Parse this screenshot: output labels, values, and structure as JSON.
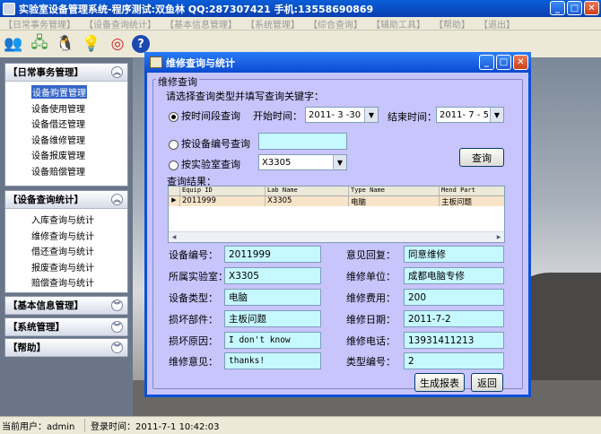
{
  "app": {
    "title": "实验室设备管理系统-程序测试:双鱼林 QQ:287307421 手机:13558690869"
  },
  "menu": [
    "【日常事务管理】",
    "【设备查询统计】",
    "【基本信息管理】",
    "【系统管理】",
    "【综合查询】",
    "【辅助工具】",
    "【帮助】",
    "【退出】"
  ],
  "sidebar": {
    "panels": [
      {
        "title": "【日常事务管理】",
        "items": [
          "设备购置管理",
          "设备使用管理",
          "设备借还管理",
          "设备维修管理",
          "设备报废管理",
          "设备赔偿管理"
        ]
      },
      {
        "title": "【设备查询统计】",
        "items": [
          "入库查询与统计",
          "维修查询与统计",
          "借还查询与统计",
          "报废查询与统计",
          "赔偿查询与统计"
        ]
      },
      {
        "title": "【基本信息管理】"
      },
      {
        "title": "【系统管理】"
      },
      {
        "title": "【帮助】"
      }
    ]
  },
  "dialog": {
    "title": "维修查询与统计",
    "group_label": "维修查询",
    "prompt": "请选择查询类型并填写查询关键字：",
    "radio_time": "按时间段查询",
    "start_label": "开始时间：",
    "start_value": "2011- 3 -30",
    "end_label": "结束时间：",
    "end_value": "2011- 7 - 5",
    "radio_equip": "按设备编号查询",
    "equip_value": "",
    "radio_lab": "按实验室查询",
    "lab_value": "X3305",
    "query_button": "查询",
    "results_label": "查询结果：",
    "grid": {
      "headers": [
        "Equip ID",
        "Lab Name",
        "Type Name",
        "Mend Part"
      ],
      "rows": [
        [
          "2011999",
          "X3305",
          "电脑",
          "主板问题"
        ]
      ]
    },
    "fields": {
      "equip_id_label": "设备编号：",
      "equip_id": "2011999",
      "lab_label": "所属实验室：",
      "lab": "X3305",
      "type_label": "设备类型：",
      "type": "电脑",
      "part_label": "损坏部件：",
      "part": "主板问题",
      "reason_label": "损坏原因：",
      "reason": "I don't know",
      "opinion_label": "维修意见：",
      "opinion": "thanks!",
      "reply_label": "意见回复：",
      "reply": "同意维修",
      "unit_label": "维修单位：",
      "unit": "成都电脑专修",
      "cost_label": "维修费用：",
      "cost": "200",
      "date_label": "维修日期：",
      "date": "2011-7-2",
      "phone_label": "维修电话：",
      "phone": "13931411213",
      "typeno_label": "类型编号：",
      "typeno": "2"
    },
    "report_button": "生成报表",
    "back_button": "返回"
  },
  "status": {
    "user": "当前用户：admin",
    "login": "登录时间：2011-7-1 10:42:03"
  }
}
